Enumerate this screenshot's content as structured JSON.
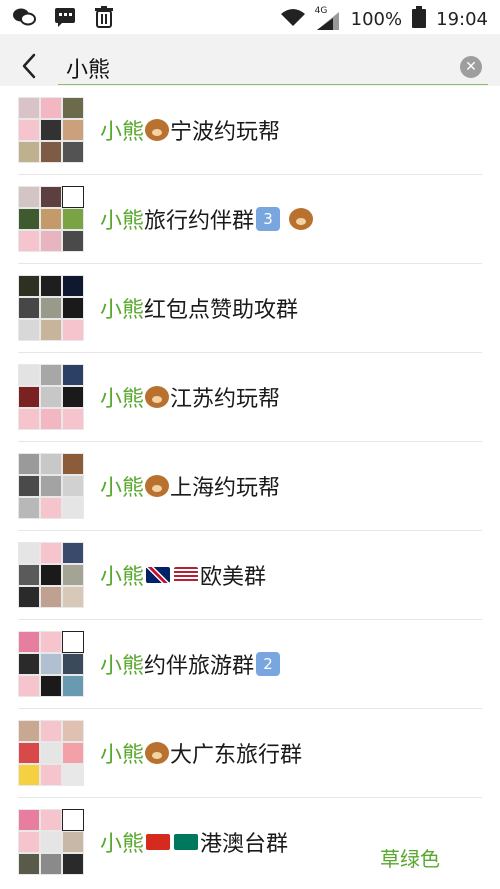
{
  "status_bar": {
    "battery_percent": "100%",
    "time": "19:04",
    "network": "4G"
  },
  "search": {
    "query": "小熊"
  },
  "rows": [
    {
      "prefix": "小熊",
      "suffix": "宁波约玩帮",
      "emoji": "bear"
    },
    {
      "prefix": "小熊",
      "suffix": "旅行约伴群",
      "num": "3",
      "emoji2": "bear"
    },
    {
      "prefix": "小熊",
      "suffix": "红包点赞助攻群"
    },
    {
      "prefix": "小熊",
      "suffix": "江苏约玩帮",
      "emoji": "bear"
    },
    {
      "prefix": "小熊",
      "suffix": "上海约玩帮",
      "emoji": "bear"
    },
    {
      "prefix": "小熊",
      "suffix": "欧美群",
      "flags": [
        "uk",
        "us"
      ]
    },
    {
      "prefix": "小熊",
      "suffix": "约伴旅游群",
      "num": "2"
    },
    {
      "prefix": "小熊",
      "suffix": "大广东旅行群",
      "emoji": "bear"
    },
    {
      "prefix": "小熊",
      "suffix": "港澳台群",
      "flags": [
        "hk",
        "mo"
      ]
    }
  ],
  "footer": {
    "note": "草绿色"
  },
  "colors": {
    "highlight": "#58a82d",
    "divider": "#e6e6e6",
    "search_bg": "#f2f2f2"
  }
}
